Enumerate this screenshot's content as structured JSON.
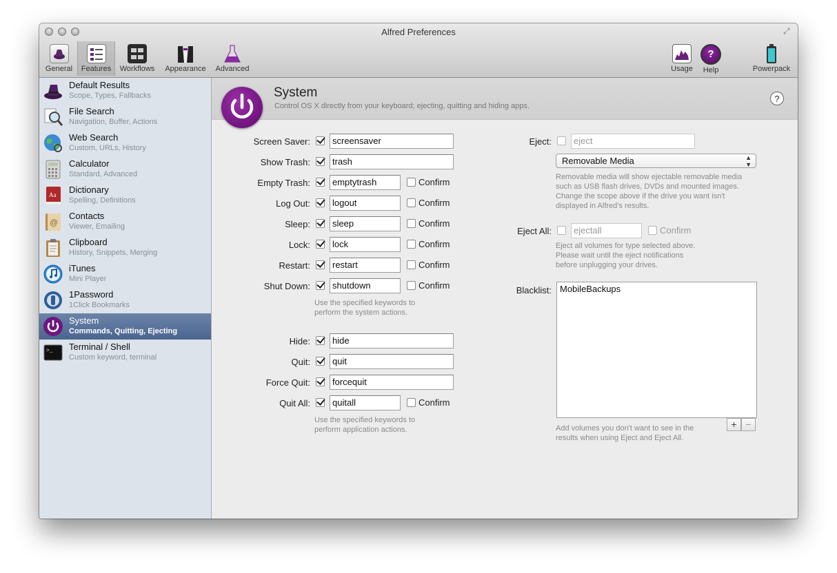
{
  "window": {
    "title": "Alfred Preferences"
  },
  "toolbar": {
    "general": "General",
    "features": "Features",
    "workflows": "Workflows",
    "appearance": "Appearance",
    "advanced": "Advanced",
    "usage": "Usage",
    "help": "Help",
    "powerpack": "Powerpack"
  },
  "sidebar": {
    "items": [
      {
        "title": "Default Results",
        "subtitle": "Scope, Types, Fallbacks"
      },
      {
        "title": "File Search",
        "subtitle": "Navigation, Buffer, Actions"
      },
      {
        "title": "Web Search",
        "subtitle": "Custom, URLs, History"
      },
      {
        "title": "Calculator",
        "subtitle": "Standard, Advanced"
      },
      {
        "title": "Dictionary",
        "subtitle": "Spelling, Definitions"
      },
      {
        "title": "Contacts",
        "subtitle": "Viewer, Emailing"
      },
      {
        "title": "Clipboard",
        "subtitle": "History, Snippets, Merging"
      },
      {
        "title": "iTunes",
        "subtitle": "Mini Player"
      },
      {
        "title": "1Password",
        "subtitle": "1Click Bookmarks"
      },
      {
        "title": "System",
        "subtitle": "Commands, Quitting, Ejecting"
      },
      {
        "title": "Terminal / Shell",
        "subtitle": "Custom keyword, terminal"
      }
    ],
    "selected_index": 9
  },
  "header": {
    "title": "System",
    "subtitle": "Control OS X directly from your keyboard; ejecting, quitting and hiding apps.",
    "help": "?"
  },
  "system_commands": [
    {
      "label": "Screen Saver:",
      "enabled": true,
      "keyword": "screensaver",
      "confirm": null
    },
    {
      "label": "Show Trash:",
      "enabled": true,
      "keyword": "trash",
      "confirm": null
    },
    {
      "label": "Empty Trash:",
      "enabled": true,
      "keyword": "emptytrash",
      "confirm": false
    },
    {
      "label": "Log Out:",
      "enabled": true,
      "keyword": "logout",
      "confirm": false
    },
    {
      "label": "Sleep:",
      "enabled": true,
      "keyword": "sleep",
      "confirm": false
    },
    {
      "label": "Lock:",
      "enabled": true,
      "keyword": "lock",
      "confirm": false
    },
    {
      "label": "Restart:",
      "enabled": true,
      "keyword": "restart",
      "confirm": false
    },
    {
      "label": "Shut Down:",
      "enabled": true,
      "keyword": "shutdown",
      "confirm": false
    }
  ],
  "system_note": [
    "Use the specified keywords to",
    "perform the system actions."
  ],
  "app_commands": [
    {
      "label": "Hide:",
      "enabled": true,
      "keyword": "hide",
      "confirm": null
    },
    {
      "label": "Quit:",
      "enabled": true,
      "keyword": "quit",
      "confirm": null
    },
    {
      "label": "Force Quit:",
      "enabled": true,
      "keyword": "forcequit",
      "confirm": null
    },
    {
      "label": "Quit All:",
      "enabled": true,
      "keyword": "quitall",
      "confirm": false
    }
  ],
  "app_note": [
    "Use the specified keywords to",
    "perform application actions."
  ],
  "confirm_label": "Confirm",
  "eject": {
    "label": "Eject:",
    "enabled": false,
    "placeholder": "eject",
    "scope": "Removable Media",
    "note": [
      "Removable media will show ejectable removable media",
      "such as USB flash drives, DVDs and mounted images.",
      "Change the scope above if the drive you want isn't",
      "displayed in Alfred's results."
    ]
  },
  "eject_all": {
    "label": "Eject All:",
    "enabled": false,
    "placeholder": "ejectall",
    "confirm": false,
    "note": [
      "Eject all volumes for type selected above.",
      "Please wait until the eject notifications",
      "before unplugging your drives."
    ]
  },
  "blacklist": {
    "label": "Blacklist:",
    "items": [
      "MobileBackups"
    ],
    "add": "+",
    "remove": "−",
    "note": [
      "Add volumes you don't want to see in the",
      "results when using Eject and Eject All."
    ]
  }
}
